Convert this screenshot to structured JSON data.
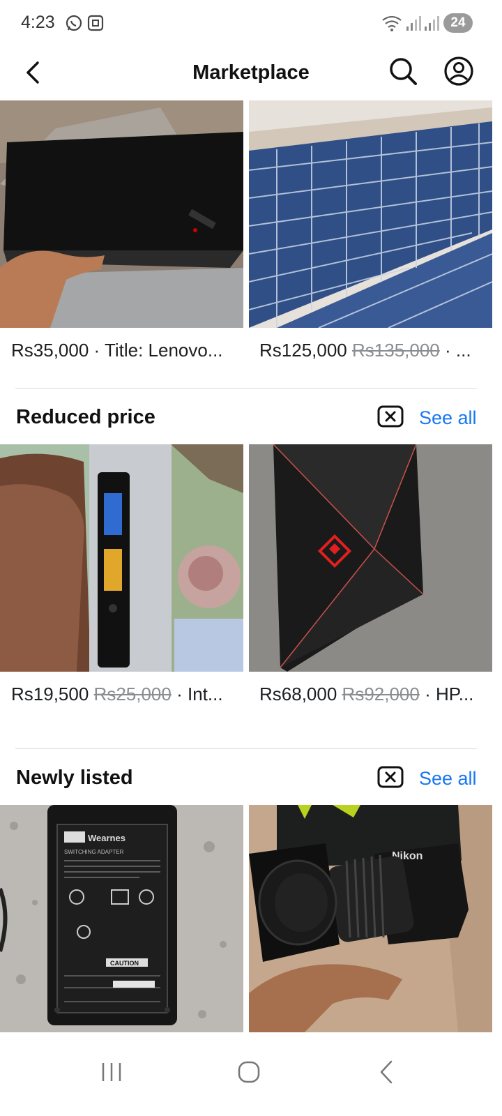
{
  "status_bar": {
    "time": "4:23",
    "battery": "24"
  },
  "header": {
    "title": "Marketplace"
  },
  "top_listings": [
    {
      "price": "Rs35,000",
      "separator": " · ",
      "title": "Title: Lenovo..."
    },
    {
      "price": "Rs125,000",
      "old_price": "Rs135,000",
      "separator": " · ",
      "title": "..."
    }
  ],
  "sections": [
    {
      "title": "Reduced price",
      "see_all": "See all",
      "listings": [
        {
          "price": "Rs19,500",
          "old_price": "Rs25,000",
          "separator": " · ",
          "title": "Int..."
        },
        {
          "price": "Rs68,000",
          "old_price": "Rs92,000",
          "separator": " · ",
          "title": "HP..."
        }
      ]
    },
    {
      "title": "Newly listed",
      "see_all": "See all"
    }
  ],
  "adapter_label": {
    "brand": "Wearnes",
    "line1": "SWITCHING ADAPTER",
    "caution": "CAUTION"
  },
  "camera_brand": "Nikon"
}
